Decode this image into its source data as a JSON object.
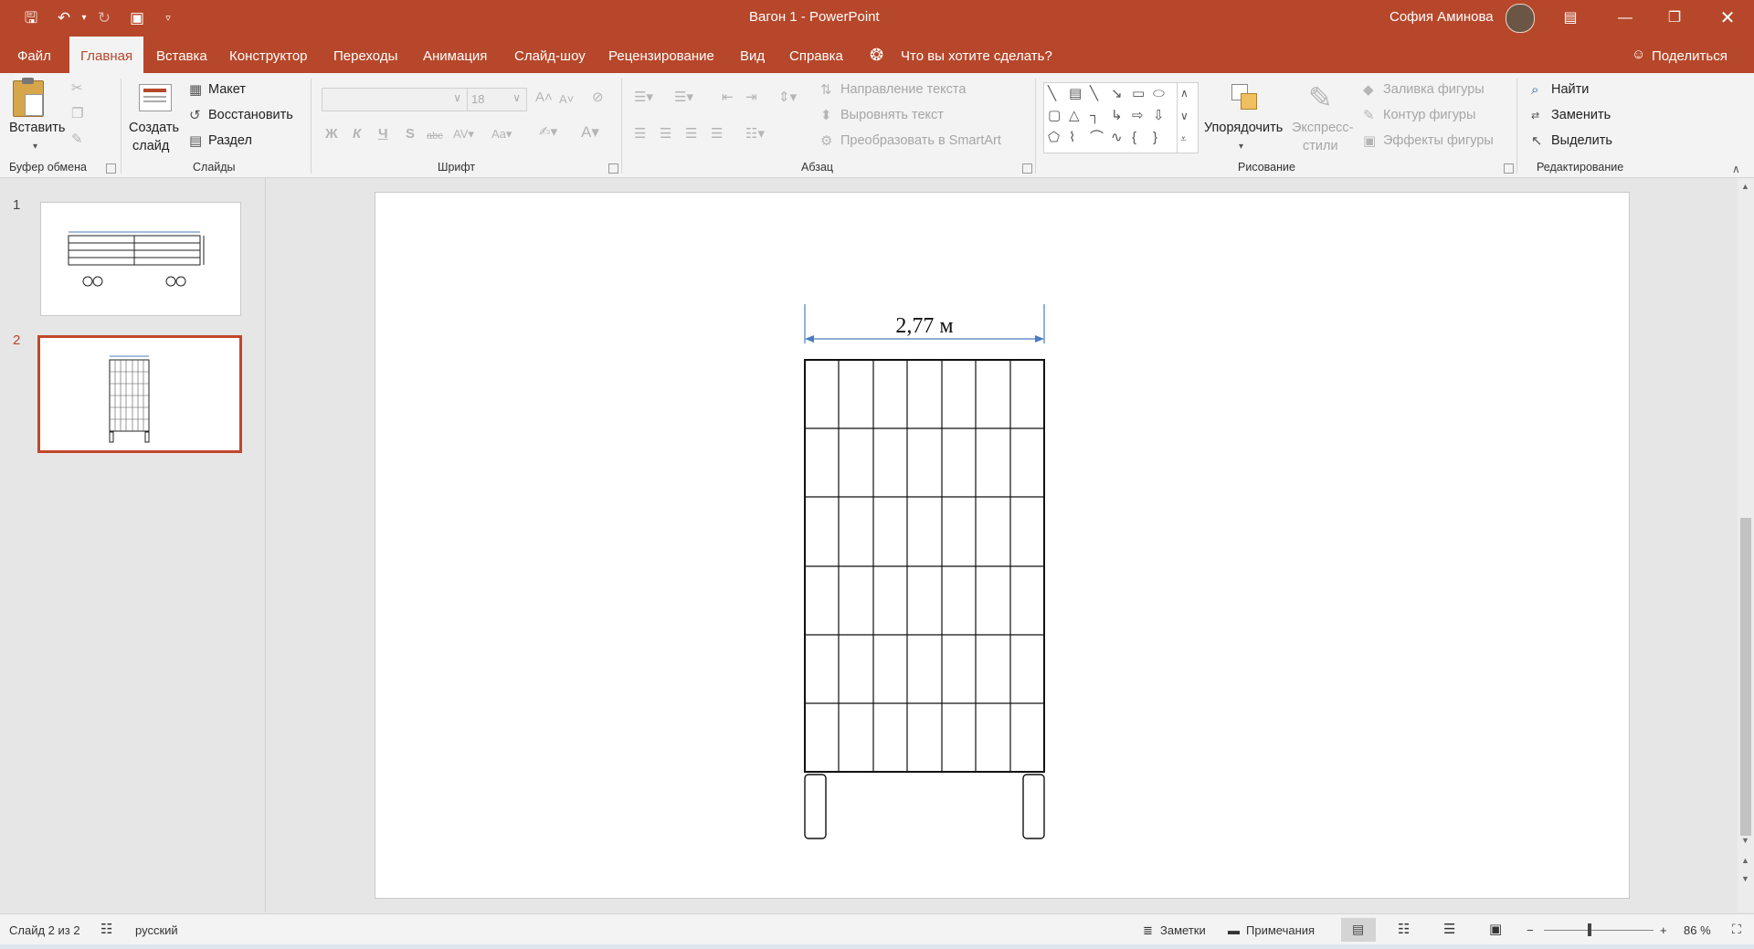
{
  "window": {
    "title": "Вагон 1  -  PowerPoint",
    "user_name": "София Аминова",
    "share_label": "Поделиться"
  },
  "tabs": [
    {
      "label": "Файл"
    },
    {
      "label": "Главная"
    },
    {
      "label": "Вставка"
    },
    {
      "label": "Конструктор"
    },
    {
      "label": "Переходы"
    },
    {
      "label": "Анимация"
    },
    {
      "label": "Слайд-шоу"
    },
    {
      "label": "Рецензирование"
    },
    {
      "label": "Вид"
    },
    {
      "label": "Справка"
    }
  ],
  "tell_me": "Что вы хотите сделать?",
  "ribbon": {
    "clipboard": {
      "paste": "Вставить",
      "group": "Буфер обмена"
    },
    "slides": {
      "new_slide_line1": "Создать",
      "new_slide_line2": "слайд",
      "layout": "Макет",
      "reset": "Восстановить",
      "section": "Раздел",
      "group": "Слайды"
    },
    "font": {
      "size": "18",
      "bold": "Ж",
      "italic": "К",
      "underline": "Ч",
      "shadow": "S",
      "strike": "abc",
      "group": "Шрифт"
    },
    "paragraph": {
      "text_direction": "Направление текста",
      "align_text": "Выровнять текст",
      "smartart": "Преобразовать в SmartArt",
      "group": "Абзац"
    },
    "drawing": {
      "arrange": "Упорядочить",
      "quick_styles_line1": "Экспресс-",
      "quick_styles_line2": "стили",
      "fill": "Заливка фигуры",
      "outline": "Контур фигуры",
      "effects": "Эффекты фигуры",
      "group": "Рисование"
    },
    "editing": {
      "find": "Найти",
      "replace": "Заменить",
      "select": "Выделить",
      "group": "Редактирование"
    }
  },
  "thumbnails": [
    {
      "number": "1"
    },
    {
      "number": "2"
    }
  ],
  "slide": {
    "dimension_label": "2,77 м"
  },
  "status": {
    "slide_counter": "Слайд 2 из 2",
    "language": "русский",
    "notes": "Заметки",
    "comments": "Примечания",
    "zoom": "86 %"
  },
  "colors": {
    "accent": "#b7472a",
    "dimension": "#4a7cc0"
  }
}
